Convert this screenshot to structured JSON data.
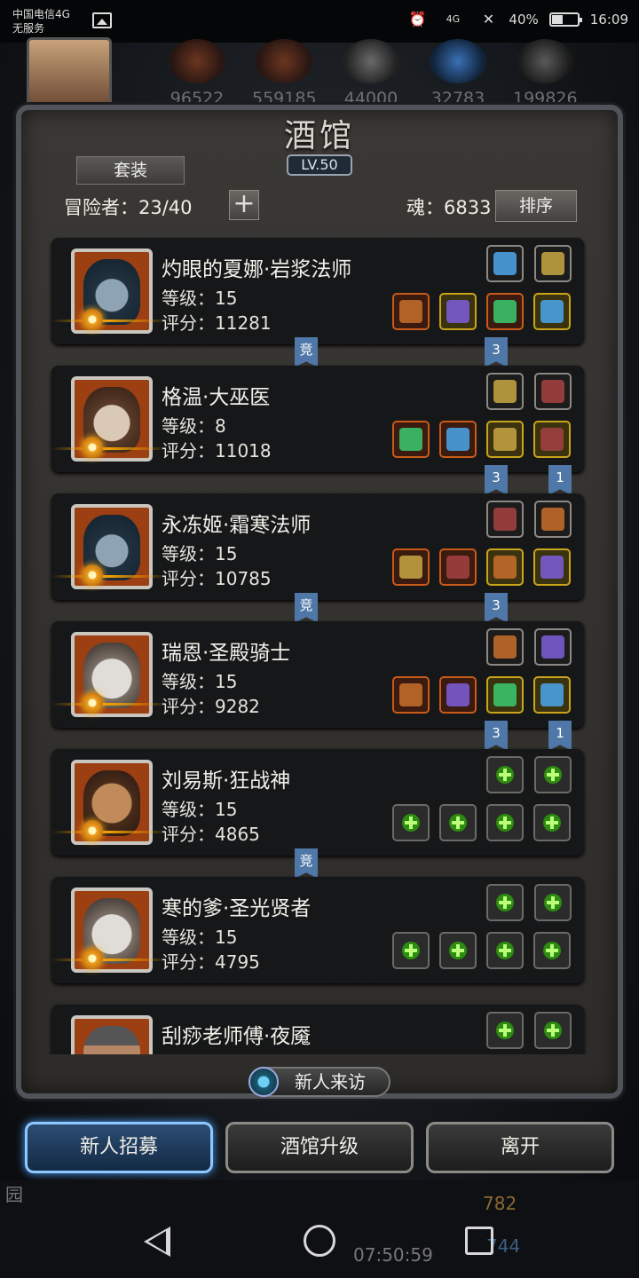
{
  "status_bar": {
    "carrier": "中国电信4G",
    "service": "无服务",
    "network": "4G",
    "battery": "40%",
    "time": "16:09"
  },
  "resources": [
    "96522",
    "559185",
    "44000",
    "32783",
    "199826"
  ],
  "tavern": {
    "title": "酒馆",
    "level": "LV.50",
    "suit_button": "套装",
    "adventurers": "冒险者：23/40",
    "plus_button": "+",
    "soul": "魂：6833",
    "sort_button": "排序",
    "new_visitor": "新人来访"
  },
  "heroes": [
    {
      "name": "灼眼的夏娜·岩浆法师",
      "level": "等级：15",
      "score": "评分：11281",
      "portrait": "mage-portrait",
      "top_slots": [
        "grey",
        "grey"
      ],
      "bottom_slots": [
        "orange",
        "yellow",
        "orange",
        "yellow"
      ],
      "tags": [
        {
          "text": "竞",
          "pos": "left"
        },
        {
          "text": "3",
          "pos": "mid"
        }
      ]
    },
    {
      "name": "格温·大巫医",
      "level": "等级：8",
      "score": "评分：11018",
      "portrait": "shaman-portrait",
      "top_slots": [
        "grey",
        "grey"
      ],
      "bottom_slots": [
        "orange",
        "orange",
        "yellow",
        "yellow"
      ],
      "tags": [
        {
          "text": "3",
          "pos": "mid"
        },
        {
          "text": "1",
          "pos": "right"
        }
      ]
    },
    {
      "name": "永冻姬·霜寒法师",
      "level": "等级：15",
      "score": "评分：10785",
      "portrait": "mage-portrait",
      "top_slots": [
        "grey",
        "grey"
      ],
      "bottom_slots": [
        "orange",
        "orange",
        "yellow",
        "yellow"
      ],
      "tags": [
        {
          "text": "竞",
          "pos": "left"
        },
        {
          "text": "3",
          "pos": "mid"
        }
      ]
    },
    {
      "name": "瑞恩·圣殿骑士",
      "level": "等级：15",
      "score": "评分：9282",
      "portrait": "knight-portrait",
      "top_slots": [
        "grey",
        "grey"
      ],
      "bottom_slots": [
        "orange",
        "orange",
        "yellow",
        "yellow"
      ],
      "tags": [
        {
          "text": "3",
          "pos": "mid"
        },
        {
          "text": "1",
          "pos": "right"
        }
      ]
    },
    {
      "name": "刘易斯·狂战神",
      "level": "等级：15",
      "score": "评分：4865",
      "portrait": "berserker-portrait",
      "top_slots": [
        "empty",
        "empty"
      ],
      "bottom_slots": [
        "empty",
        "empty",
        "empty",
        "empty"
      ],
      "tags": [
        {
          "text": "竞",
          "pos": "left"
        }
      ]
    },
    {
      "name": "寒的爹·圣光贤者",
      "level": "等级：15",
      "score": "评分：4795",
      "portrait": "knight-portrait",
      "top_slots": [
        "empty",
        "empty"
      ],
      "bottom_slots": [
        "empty",
        "empty",
        "empty",
        "empty"
      ],
      "tags": []
    },
    {
      "name": "刮痧老师傅·夜魇",
      "level": "",
      "score": "",
      "portrait": "helm-portrait",
      "top_slots": [
        "empty",
        "empty"
      ],
      "bottom_slots": [],
      "tags": []
    }
  ],
  "bottom_buttons": {
    "recruit": "新人招募",
    "upgrade": "酒馆升级",
    "leave": "离开"
  },
  "background": {
    "yuan": "园",
    "timer": "07:50:59",
    "res_a": "782",
    "res_b": "744"
  },
  "colors": {
    "active_button": "#4aa0ff",
    "tag": "#4f78a8",
    "empty_slot_cross": "#2e8b12"
  }
}
